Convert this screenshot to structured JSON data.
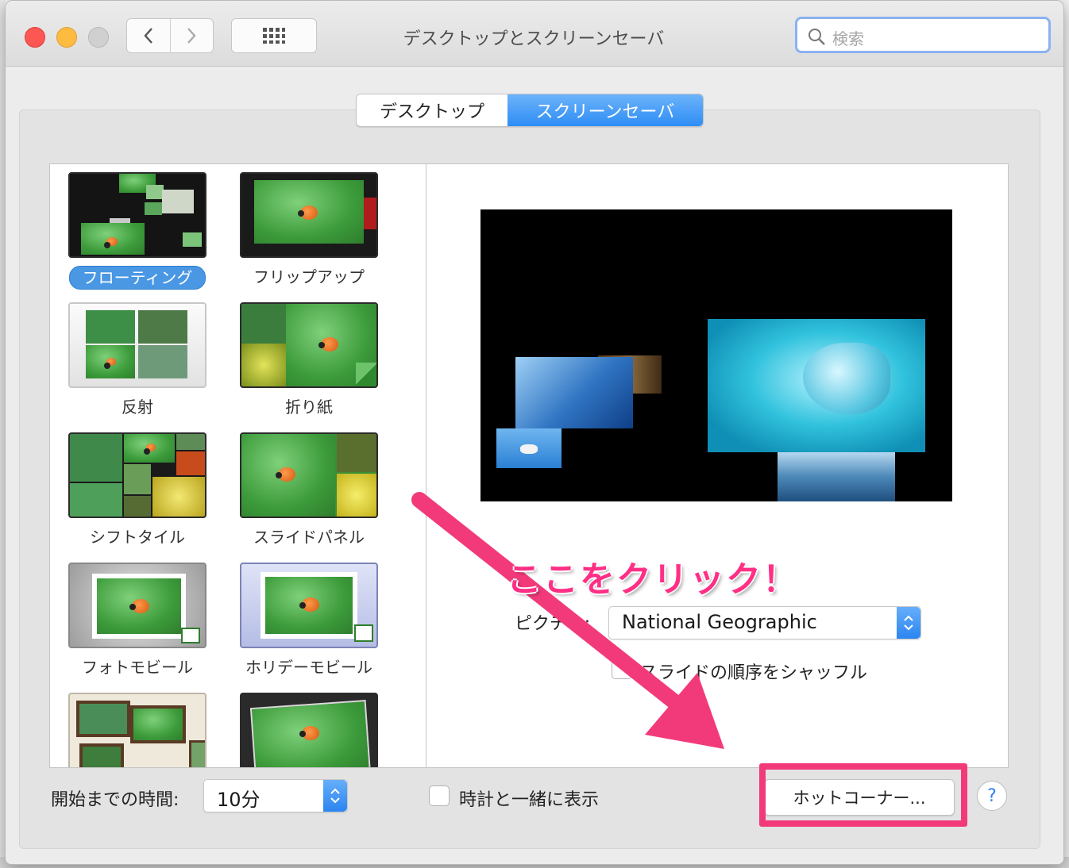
{
  "window": {
    "title": "デスクトップとスクリーンセーバ",
    "search_placeholder": "検索"
  },
  "tabs": [
    {
      "label": "デスクトップ",
      "selected": false
    },
    {
      "label": "スクリーンセーバ",
      "selected": true
    }
  ],
  "savers": [
    {
      "label": "フローティング",
      "selected": true
    },
    {
      "label": "フリップアップ",
      "selected": false
    },
    {
      "label": "反射",
      "selected": false
    },
    {
      "label": "折り紙",
      "selected": false
    },
    {
      "label": "シフトタイル",
      "selected": false
    },
    {
      "label": "スライドパネル",
      "selected": false
    },
    {
      "label": "フォトモビール",
      "selected": false
    },
    {
      "label": "ホリデーモビール",
      "selected": false
    }
  ],
  "options": {
    "picture_label": "ピクチャ:",
    "picture_value": "National Geographic",
    "shuffle_label": "スライドの順序をシャッフル",
    "shuffle_checked": false
  },
  "bottom": {
    "start_label": "開始までの時間:",
    "start_value": "10分",
    "clock_label": "時計と一緒に表示",
    "clock_checked": false,
    "hot_corners_label": "ホットコーナー...",
    "help_label": "?"
  },
  "annotation": {
    "text": "ここをクリック！",
    "color": "#f23a7b"
  },
  "colors": {
    "accent": "#2e8df5",
    "highlight": "#f23a7b"
  }
}
